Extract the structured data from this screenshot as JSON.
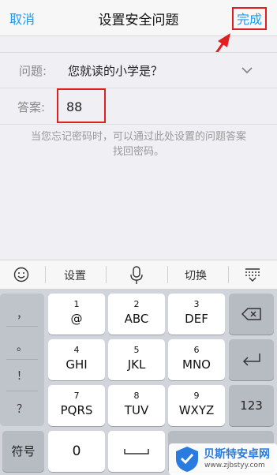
{
  "nav": {
    "cancel_label": "取消",
    "title": "设置安全问题",
    "done_label": "完成"
  },
  "form": {
    "question_label": "问题:",
    "question_value": "您就读的小学是？",
    "answer_label": "答案:",
    "answer_value": "88",
    "hint_line1": "当您忘记密码时，可以通过此处设置的问题答案",
    "hint_line2": "找回密码。"
  },
  "candidate_bar": {
    "emoji_icon": "emoji-icon",
    "settings_label": "设置",
    "mic_icon": "microphone-icon",
    "switch_label": "切换",
    "hide_icon": "keyboard-hide-icon"
  },
  "keyboard": {
    "side_keys": [
      "，",
      "。",
      "！",
      "？"
    ],
    "keys": [
      {
        "num": "1",
        "letters": "@"
      },
      {
        "num": "2",
        "letters": "ABC"
      },
      {
        "num": "3",
        "letters": "DEF"
      },
      {
        "num": "4",
        "letters": "GHI"
      },
      {
        "num": "5",
        "letters": "JKL"
      },
      {
        "num": "6",
        "letters": "MNO"
      },
      {
        "num": "7",
        "letters": "PQRS"
      },
      {
        "num": "8",
        "letters": "TUV"
      },
      {
        "num": "9",
        "letters": "WXYZ"
      }
    ],
    "symbols_label": "符号",
    "zero_label": "0",
    "num123_label": "123",
    "backspace_icon": "backspace-icon",
    "enter_icon": "enter-icon",
    "space_icon": "space-icon"
  },
  "watermark": {
    "title": "贝斯特安卓网",
    "url": "www.zjbstyy.com"
  },
  "colors": {
    "accent": "#1e9bf0",
    "highlight": "#e02020"
  }
}
